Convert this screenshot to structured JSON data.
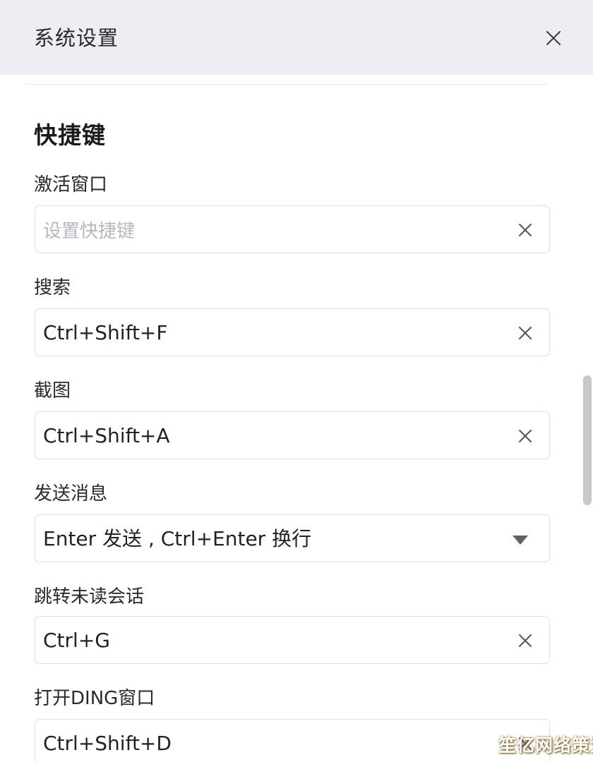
{
  "dialog": {
    "title": "系统设置",
    "section_title": "快捷键"
  },
  "fields": [
    {
      "label": "激活窗口",
      "value": "",
      "placeholder": "设置快捷键",
      "control": "clear"
    },
    {
      "label": "搜索",
      "value": "Ctrl+Shift+F",
      "control": "clear"
    },
    {
      "label": "截图",
      "value": "Ctrl+Shift+A",
      "control": "clear"
    },
    {
      "label": "发送消息",
      "value": "Enter 发送 , Ctrl+Enter 换行",
      "control": "dropdown"
    },
    {
      "label": "跳转未读会话",
      "value": "Ctrl+G",
      "control": "clear"
    },
    {
      "label": "打开DING窗口",
      "value": "Ctrl+Shift+D",
      "control": "clear"
    }
  ],
  "icons": {
    "close": "close-icon",
    "clear": "clear-icon",
    "dropdown": "caret-down-icon"
  },
  "watermark": "笙亿网络策划",
  "colors": {
    "titlebar_bg": "#eceef3",
    "border": "#dcdfe6",
    "placeholder": "#b5b8bf"
  }
}
